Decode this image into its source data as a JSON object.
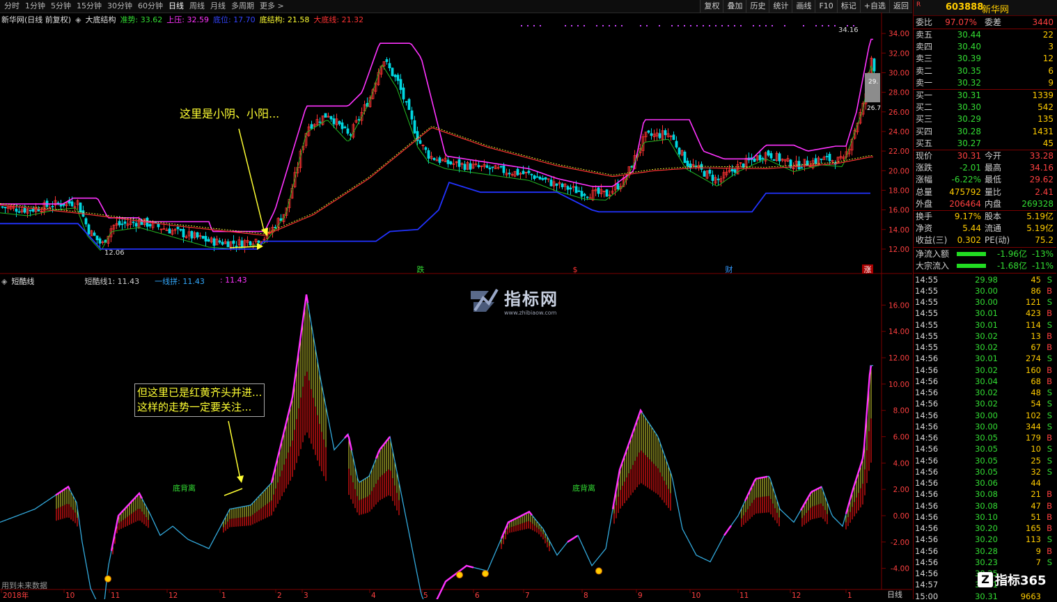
{
  "toolbar": {
    "periods": [
      "分时",
      "1分钟",
      "5分钟",
      "15分钟",
      "30分钟",
      "60分钟",
      "日线",
      "周线",
      "月线",
      "多周期",
      "更多 >"
    ],
    "active_period": "日线",
    "tools": [
      "复权",
      "叠加",
      "历史",
      "统计",
      "画线",
      "F10",
      "标记",
      "+自选",
      "返回"
    ]
  },
  "main_info": {
    "title": "新华网(日线 前复权)",
    "indicator": "大底结构",
    "items": [
      {
        "label": "准势: 33.62",
        "color": "#33dd33"
      },
      {
        "label": "上压: 32.59",
        "color": "#ff33ff"
      },
      {
        "label": "底位: 17.70",
        "color": "#3344ff"
      },
      {
        "label": "底结构: 21.58",
        "color": "#ffff33"
      },
      {
        "label": "大底线: 21.32",
        "color": "#ff3333"
      }
    ]
  },
  "sub_info": {
    "indicator": "短酷线",
    "items": [
      {
        "label": "短酷线1: 11.43",
        "color": "#d0d0d0"
      },
      {
        "label": "一线拼: 11.43",
        "color": "#33aaff"
      },
      {
        "label": ": 11.43",
        "color": "#ff33ff"
      }
    ]
  },
  "chart_data": [
    {
      "type": "candlestick",
      "title": "",
      "ylim": [
        11,
        35
      ],
      "y_ticks": [
        "34.00",
        "32.00",
        "30.00",
        "28.00",
        "26.00",
        "24.00",
        "22.00",
        "20.00",
        "18.00",
        "16.00",
        "14.00",
        "12.00"
      ],
      "price_labels": {
        "high": "34.16",
        "low": "12.06",
        "box_top": "29.",
        "box_mid": "26.7"
      },
      "markers": [
        {
          "label": "跌",
          "color": "#33dd33"
        },
        {
          "label": "$",
          "color": "#ff3333"
        },
        {
          "label": "财",
          "color": "#3399ff"
        },
        {
          "label": "涨",
          "color": "#ff3333"
        }
      ],
      "annotation": "这里是小阴、小阳..."
    },
    {
      "type": "area",
      "title": "",
      "ylim": [
        -5.5,
        17.5
      ],
      "y_ticks": [
        "16.00",
        "14.00",
        "12.00",
        "10.00",
        "8.00",
        "6.00",
        "4.00",
        "2.00",
        "0.00",
        "-2.00",
        "-4.00"
      ],
      "labels": [
        "底背离",
        "底背离"
      ],
      "annotation_lines": [
        "但这里已是红黄齐头并进...",
        "这样的走势一定要关注..."
      ]
    }
  ],
  "x_axis": {
    "labels": [
      "2018年",
      "10",
      "11",
      "12",
      "1",
      "2",
      "3",
      "4",
      "5",
      "6",
      "7",
      "8",
      "9",
      "10",
      "11",
      "12",
      "1"
    ],
    "period_label": "日线"
  },
  "footer_note": "用到未来数据",
  "watermark": {
    "brand": "指标网",
    "url": "www.zhibiaow.com"
  },
  "corner_logo": "指标365",
  "stock": {
    "code": "603888",
    "name": "新华网",
    "tag": "R"
  },
  "order_book": {
    "ratio": {
      "label": "委比",
      "value": "97.07%",
      "label2": "委差",
      "value2": "3440"
    },
    "asks": [
      {
        "label": "卖五",
        "price": "30.44",
        "vol": "22"
      },
      {
        "label": "卖四",
        "price": "30.40",
        "vol": "3"
      },
      {
        "label": "卖三",
        "price": "30.39",
        "vol": "12"
      },
      {
        "label": "卖二",
        "price": "30.35",
        "vol": "6"
      },
      {
        "label": "卖一",
        "price": "30.32",
        "vol": "9"
      }
    ],
    "bids": [
      {
        "label": "买一",
        "price": "30.31",
        "vol": "1339"
      },
      {
        "label": "买二",
        "price": "30.30",
        "vol": "542"
      },
      {
        "label": "买三",
        "price": "30.29",
        "vol": "135"
      },
      {
        "label": "买四",
        "price": "30.28",
        "vol": "1431"
      },
      {
        "label": "买五",
        "price": "30.27",
        "vol": "45"
      }
    ]
  },
  "quote": [
    {
      "l1": "现价",
      "v1": "30.31",
      "c1": "red",
      "l2": "今开",
      "v2": "33.28",
      "c2": "red"
    },
    {
      "l1": "涨跌",
      "v1": "-2.01",
      "c1": "green",
      "l2": "最高",
      "v2": "34.16",
      "c2": "red"
    },
    {
      "l1": "涨幅",
      "v1": "-6.22%",
      "c1": "green",
      "l2": "最低",
      "v2": "29.62",
      "c2": "red"
    },
    {
      "l1": "总量",
      "v1": "475792",
      "c1": "yel",
      "l2": "量比",
      "v2": "2.41",
      "c2": "red"
    },
    {
      "l1": "外盘",
      "v1": "206464",
      "c1": "red",
      "l2": "内盘",
      "v2": "269328",
      "c2": "green"
    }
  ],
  "stats": [
    {
      "l1": "换手",
      "v1": "9.17%",
      "l2": "股本",
      "v2": "5.19亿"
    },
    {
      "l1": "净资",
      "v1": "5.44",
      "l2": "流通",
      "v2": "5.19亿"
    },
    {
      "l1": "收益(三)",
      "v1": "0.302",
      "l2": "PE(动)",
      "v2": "75.2"
    }
  ],
  "flows": [
    {
      "label": "净流入额",
      "value": "-1.96亿",
      "pct": "-13%"
    },
    {
      "label": "大宗流入",
      "value": "-1.68亿",
      "pct": "-11%"
    }
  ],
  "ticks": [
    {
      "t": "14:55",
      "p": "29.98",
      "v": "45",
      "bs": "S"
    },
    {
      "t": "14:55",
      "p": "30.00",
      "v": "86",
      "bs": "B"
    },
    {
      "t": "14:55",
      "p": "30.00",
      "v": "121",
      "bs": "S"
    },
    {
      "t": "14:55",
      "p": "30.01",
      "v": "423",
      "bs": "B"
    },
    {
      "t": "14:55",
      "p": "30.01",
      "v": "114",
      "bs": "S"
    },
    {
      "t": "14:55",
      "p": "30.02",
      "v": "13",
      "bs": "B"
    },
    {
      "t": "14:55",
      "p": "30.02",
      "v": "67",
      "bs": "B"
    },
    {
      "t": "14:56",
      "p": "30.01",
      "v": "274",
      "bs": "S"
    },
    {
      "t": "14:56",
      "p": "30.02",
      "v": "160",
      "bs": "B"
    },
    {
      "t": "14:56",
      "p": "30.04",
      "v": "68",
      "bs": "B"
    },
    {
      "t": "14:56",
      "p": "30.02",
      "v": "48",
      "bs": "S"
    },
    {
      "t": "14:56",
      "p": "30.02",
      "v": "54",
      "bs": "S"
    },
    {
      "t": "14:56",
      "p": "30.00",
      "v": "102",
      "bs": "S"
    },
    {
      "t": "14:56",
      "p": "30.00",
      "v": "344",
      "bs": "S"
    },
    {
      "t": "14:56",
      "p": "30.05",
      "v": "179",
      "bs": "B"
    },
    {
      "t": "14:56",
      "p": "30.05",
      "v": "10",
      "bs": "S"
    },
    {
      "t": "14:56",
      "p": "30.05",
      "v": "25",
      "bs": "S"
    },
    {
      "t": "14:56",
      "p": "30.05",
      "v": "32",
      "bs": "S"
    },
    {
      "t": "14:56",
      "p": "30.06",
      "v": "44",
      "bs": ""
    },
    {
      "t": "14:56",
      "p": "30.08",
      "v": "21",
      "bs": "B"
    },
    {
      "t": "14:56",
      "p": "30.08",
      "v": "47",
      "bs": "B"
    },
    {
      "t": "14:56",
      "p": "30.10",
      "v": "51",
      "bs": "B"
    },
    {
      "t": "14:56",
      "p": "30.20",
      "v": "165",
      "bs": "B"
    },
    {
      "t": "14:56",
      "p": "30.20",
      "v": "113",
      "bs": "S"
    },
    {
      "t": "14:56",
      "p": "30.28",
      "v": "9",
      "bs": "B"
    },
    {
      "t": "14:56",
      "p": "30.23",
      "v": "7",
      "bs": "S"
    },
    {
      "t": "14:56",
      "p": "30.25",
      "v": "",
      "bs": ""
    },
    {
      "t": "14:57",
      "p": "30.31",
      "v": "",
      "bs": ""
    },
    {
      "t": "15:00",
      "p": "30.31",
      "v": "9663",
      "bs": ""
    }
  ],
  "colors": {
    "up": "#ff3333",
    "down": "#00d7e0",
    "magenta": "#ff33ff",
    "blue": "#2233ff",
    "green": "#33dd33",
    "yellow": "#ffff33",
    "border": "#7a0000"
  }
}
